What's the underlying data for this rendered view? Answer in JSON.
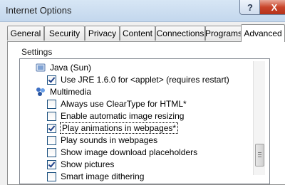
{
  "window": {
    "title": "Internet Options",
    "help_glyph": "?",
    "close_glyph": "X"
  },
  "tabs": [
    {
      "label": "General",
      "active": false
    },
    {
      "label": "Security",
      "active": false
    },
    {
      "label": "Privacy",
      "active": false
    },
    {
      "label": "Content",
      "active": false
    },
    {
      "label": "Connections",
      "active": false
    },
    {
      "label": "Programs",
      "active": false
    },
    {
      "label": "Advanced",
      "active": true
    }
  ],
  "settings_label": "Settings",
  "list": [
    {
      "type": "group",
      "label": "Java (Sun)",
      "icon": "java-icon"
    },
    {
      "type": "check",
      "label": "Use JRE 1.6.0 for <applet> (requires restart)",
      "checked": true
    },
    {
      "type": "group",
      "label": "Multimedia",
      "icon": "multimedia-icon"
    },
    {
      "type": "check",
      "label": "Always use ClearType for HTML*",
      "checked": false
    },
    {
      "type": "check",
      "label": "Enable automatic image resizing",
      "checked": false
    },
    {
      "type": "check",
      "label": "Play animations in webpages*",
      "checked": true,
      "focused": true
    },
    {
      "type": "check",
      "label": "Play sounds in webpages",
      "checked": false
    },
    {
      "type": "check",
      "label": "Show image download placeholders",
      "checked": false
    },
    {
      "type": "check",
      "label": "Show pictures",
      "checked": true
    },
    {
      "type": "check",
      "label": "Smart image dithering",
      "checked": false
    }
  ]
}
